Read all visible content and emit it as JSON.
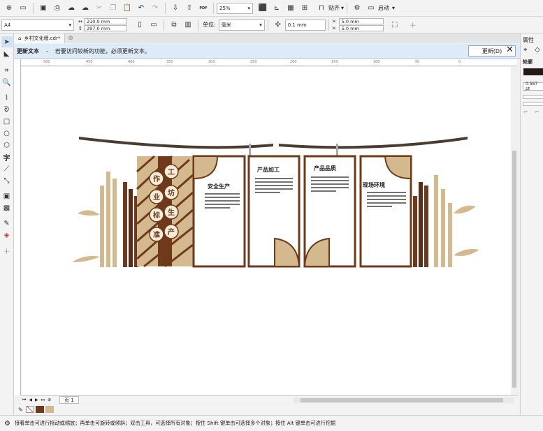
{
  "toolbar": {
    "zoom": "25%",
    "snap_label": "贴齐",
    "launch_label": "启动",
    "pdf_label": "PDF"
  },
  "property_bar": {
    "page_size": "A4",
    "width": "210.0 mm",
    "height": "297.0 mm",
    "unit_label": "单位:",
    "unit_value": "毫米",
    "nudge": "0.1 mm",
    "dup_x": "5.0 mm",
    "dup_y": "5.0 mm"
  },
  "tabs": {
    "doc_name": "乡村文化墙.cdr*"
  },
  "notice": {
    "title": "更新文本",
    "dash": "-",
    "message": "若要访问较新的功能，必须更新文本。",
    "update_button": "更新(D)"
  },
  "ruler": {
    "marks": [
      "500",
      "450",
      "400",
      "350",
      "300",
      "250",
      "200",
      "150",
      "100",
      "50",
      "0"
    ]
  },
  "right_panel": {
    "title": "属性",
    "outline_label": "轮廓",
    "outline_width": "0.567 pt"
  },
  "artwork": {
    "panel_titles": [
      "安全生产",
      "产品加工",
      "产品品质",
      "现场环境"
    ],
    "characters": [
      "作",
      "工",
      "业",
      "坊",
      "标",
      "生",
      "准",
      "产"
    ]
  },
  "page_nav": {
    "page_label": "页 1"
  },
  "status": {
    "text": "接着单击可进行拖动或缩放；再单击可旋转或倾斜；双击工具，可选择所有对象；按住 Shift 键单击可选择多个对象；按住 Alt 键单击可进行挖掘"
  },
  "colors": {
    "brown": "#6e3a1c",
    "tan": "#d4b98e",
    "dark_bar": "#4a3c30",
    "notice_bg": "#ddeaf7"
  }
}
